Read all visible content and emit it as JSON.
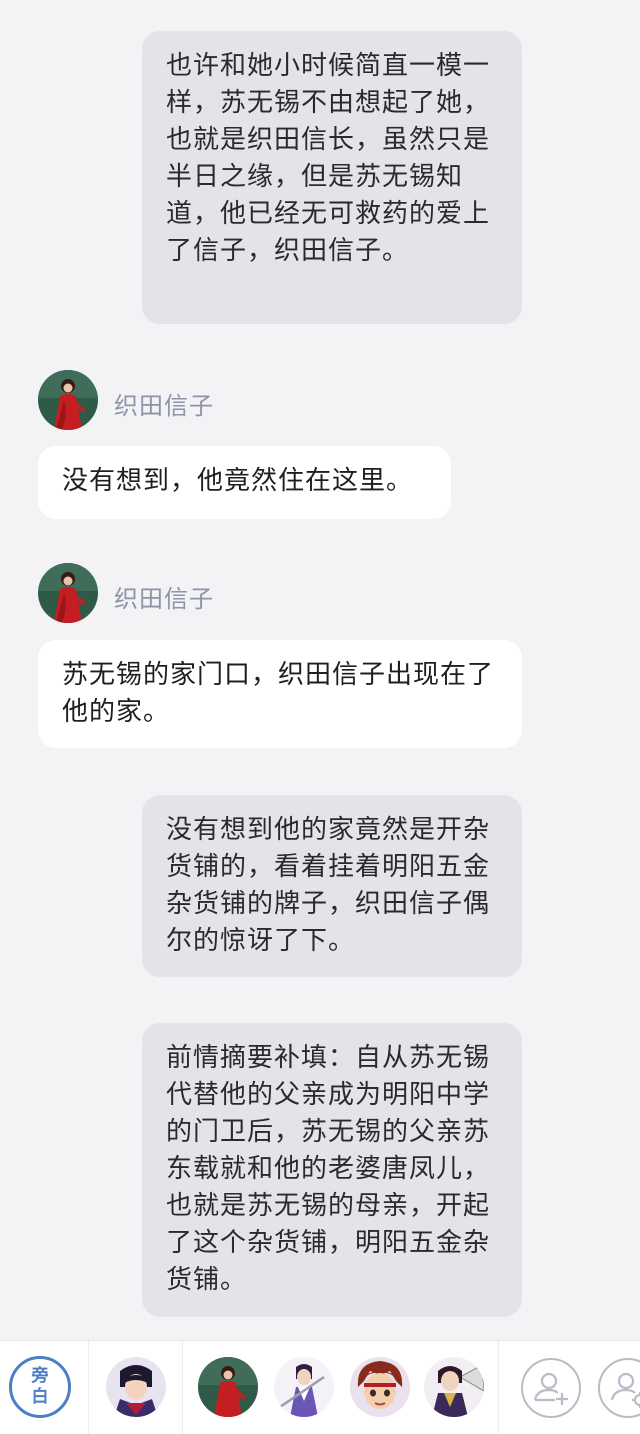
{
  "messages": [
    {
      "type": "narration",
      "text": "也许和她小时候简直一模一样，苏无锡不由想起了她，也就是织田信长，虽然只是半日之缘，但是苏无锡知道，他已经无可救药的爱上了信子，织田信子。"
    },
    {
      "type": "dialogue",
      "speaker": "织田信子",
      "text": "没有想到，他竟然住在这里。"
    },
    {
      "type": "dialogue",
      "speaker": "织田信子",
      "text": "苏无锡的家门口，织田信子出现在了他的家。"
    },
    {
      "type": "narration",
      "text": "没有想到他的家竟然是开杂货铺的，看着挂着明阳五金杂货铺的牌子，织田信子偶尔的惊讶了下。"
    },
    {
      "type": "narration",
      "text": "前情摘要补填：自从苏无锡代替他的父亲成为明阳中学的门卫后，苏无锡的父亲苏东载就和他的老婆唐凤儿，也就是苏无锡的母亲，开起了这个杂货铺，明阳五金杂货铺。"
    }
  ],
  "toolbar": {
    "narration_button": {
      "line1": "旁",
      "line2": "白"
    },
    "characters": [
      {
        "icon": "character-avatar-1"
      },
      {
        "icon": "character-avatar-2"
      },
      {
        "icon": "character-avatar-3"
      },
      {
        "icon": "character-avatar-4"
      },
      {
        "icon": "character-avatar-5"
      }
    ],
    "actions": [
      {
        "icon": "add-character-icon"
      },
      {
        "icon": "character-settings-icon"
      }
    ]
  },
  "colors": {
    "background": "#f3f3f5",
    "narration_bubble": "#e3e4ea",
    "dialogue_bubble": "#ffffff",
    "speaker_name": "#8d93a8",
    "accent": "#4a7ec5"
  }
}
